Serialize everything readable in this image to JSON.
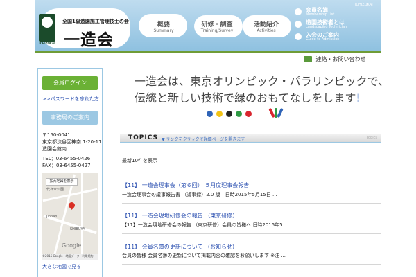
{
  "header": {
    "logo_caption": "ICHIZOKAI",
    "org_subtitle": "全国1級造園施工管理技士の会",
    "org_name": "一造会",
    "corner_tag": "ICHIZOKAI",
    "nav": [
      {
        "jp": "概要",
        "en": "Summary"
      },
      {
        "jp": "研修・調査",
        "en": "Training/Survey"
      },
      {
        "jp": "活動紹介",
        "en": "Activities"
      }
    ],
    "side_links": [
      {
        "jp": "会員名簿",
        "en": "Membership List"
      },
      {
        "jp": "造園技術者とは",
        "en": "Landscaping Technician"
      },
      {
        "jp": "入会のご案内",
        "en": "Guide to Admission"
      }
    ],
    "contact": "連絡・お問い合わせ"
  },
  "sidebar": {
    "green_button": "会員ログイン",
    "link_a": ">>パスワードを忘れた方",
    "blue_button": "事務局のご案内",
    "address_lines": [
      "〒150-0041",
      "東京都渋谷区神南 1-20-11",
      "造園会館内"
    ],
    "tel": "TEL：03-6455-0426",
    "fax": "FAX：03-6455-0427",
    "map": {
      "button": "拡大地図を表示",
      "logo": "Google",
      "copyright": "©2015 Google - 地図データ　利用規約",
      "labels": [
        "代々木公園",
        "Jinnan",
        "SHIBUYA"
      ]
    },
    "link_b": "大きな地図で見る"
  },
  "hero": {
    "line1": "一造会は、東京オリンピック・パラリンピックで、",
    "line2": "伝統と新しい技術で緑のおもてなしをします",
    "bang": "!"
  },
  "colors": {
    "rings": [
      "#2f64b7",
      "#f2c316",
      "#222222",
      "#2f9a45",
      "#d8262f"
    ],
    "leaves": [
      "#d8262f",
      "#2f9a45",
      "#2f64b7"
    ]
  },
  "topics": {
    "title": "TOPICS",
    "hint": "▼ リンクをクリックで詳細ページを開きます",
    "corner": "Topics",
    "latest_label": "最新10件を表示",
    "items": [
      {
        "title": "【11】 一造会理事会（第６回） ５月度理事会報告",
        "body": "一造会理事会の議事報告書 （議事録）2.0 版　日時2015年5月15日 ..."
      },
      {
        "title": "【11】 一造会現地研修会の報告 （東京研修）",
        "body": "【11】一造会現地研修会の報告 （東京研修）会員の皆様へ 日時2015年5 ..."
      },
      {
        "title": "【11】 会員名簿の更新について （お知らせ）",
        "body": "会員の皆様 会員名簿の更新について掲載内容の確認をお願いします ※注 ..."
      }
    ]
  }
}
